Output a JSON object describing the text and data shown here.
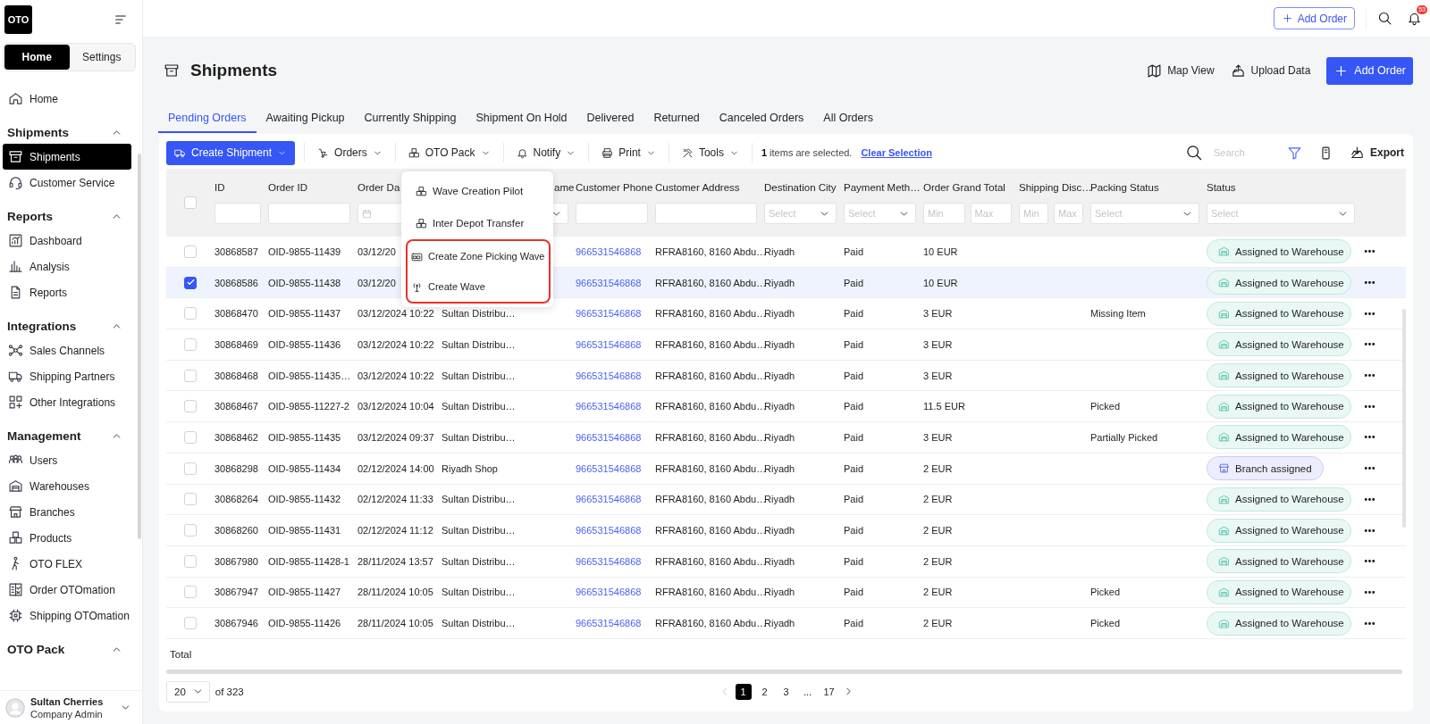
{
  "header": {
    "logo": "OTO",
    "add_order": "Add Order",
    "notifications": "53"
  },
  "sidebar": {
    "switch": [
      {
        "label": "Home",
        "selected": true
      },
      {
        "label": "Settings",
        "selected": false
      }
    ],
    "nav": [
      {
        "kind": "item",
        "label": "Home",
        "selected": false
      },
      {
        "kind": "section",
        "label": "Shipments",
        "expanded": true
      },
      {
        "kind": "item",
        "label": "Shipments",
        "selected": true
      },
      {
        "kind": "item",
        "label": "Customer Service",
        "selected": false
      },
      {
        "kind": "section",
        "label": "Reports",
        "expanded": true
      },
      {
        "kind": "item",
        "label": "Dashboard",
        "selected": false
      },
      {
        "kind": "item",
        "label": "Analysis",
        "selected": false
      },
      {
        "kind": "item",
        "label": "Reports",
        "selected": false
      },
      {
        "kind": "section",
        "label": "Integrations",
        "expanded": true
      },
      {
        "kind": "item",
        "label": "Sales Channels",
        "selected": false
      },
      {
        "kind": "item",
        "label": "Shipping Partners",
        "selected": false
      },
      {
        "kind": "item",
        "label": "Other Integrations",
        "selected": false
      },
      {
        "kind": "section",
        "label": "Management",
        "expanded": true
      },
      {
        "kind": "item",
        "label": "Users",
        "selected": false
      },
      {
        "kind": "item",
        "label": "Warehouses",
        "selected": false
      },
      {
        "kind": "item",
        "label": "Branches",
        "selected": false
      },
      {
        "kind": "item",
        "label": "Products",
        "selected": false
      },
      {
        "kind": "item",
        "label": "OTO FLEX",
        "selected": false
      },
      {
        "kind": "item",
        "label": "Order OTOmation",
        "selected": false
      },
      {
        "kind": "item",
        "label": "Shipping OTOmation",
        "selected": false
      },
      {
        "kind": "section",
        "label": "OTO Pack",
        "expanded": true
      }
    ],
    "user": {
      "name": "Sultan Cherries",
      "role": "Company Admin"
    }
  },
  "page": {
    "title": "Shipments",
    "actions": [
      {
        "kind": "link",
        "label": "Map View"
      },
      {
        "kind": "link",
        "label": "Upload Data"
      },
      {
        "kind": "primary",
        "label": "Add Order"
      }
    ]
  },
  "tabs": [
    {
      "label": "Pending Orders",
      "selected": true
    },
    {
      "label": "Awaiting Pickup",
      "selected": false
    },
    {
      "label": "Currently Shipping",
      "selected": false
    },
    {
      "label": "Shipment On Hold",
      "selected": false
    },
    {
      "label": "Delivered",
      "selected": false
    },
    {
      "label": "Returned",
      "selected": false
    },
    {
      "label": "Canceled Orders",
      "selected": false
    },
    {
      "label": "All Orders",
      "selected": false
    }
  ],
  "toolbar": {
    "buttons": [
      {
        "kind": "primary",
        "label": "Create Shipment"
      },
      {
        "kind": "menu",
        "label": "Orders"
      },
      {
        "kind": "menu",
        "label": "OTO Pack"
      },
      {
        "kind": "menu",
        "label": "Notify"
      },
      {
        "kind": "menu",
        "label": "Print"
      },
      {
        "kind": "menu",
        "label": "Tools"
      }
    ],
    "selection_note": "**1** items are selected.",
    "clear_link": "Clear Selection",
    "search": {
      "placeholder": "Search"
    },
    "export": "Export"
  },
  "menu": {
    "items": [
      {
        "label": "Wave Creation Pilot",
        "highlighted": false
      },
      {
        "label": "Inter Depot Transfer",
        "highlighted": false
      },
      {
        "label": "Create Zone Picking Wave",
        "highlighted": true
      },
      {
        "label": "Create Wave",
        "highlighted": true
      }
    ]
  },
  "table": {
    "select_all": {
      "checked": false
    },
    "columns": [
      {
        "label": "ID",
        "filter": {
          "kind": "text"
        }
      },
      {
        "label": "Order ID",
        "filter": {
          "kind": "text"
        }
      },
      {
        "label": "Order Da",
        "filter": {
          "kind": "date"
        }
      },
      {
        "label": "ame",
        "filter": {
          "kind": "select"
        }
      },
      {
        "label": "Customer Phone",
        "filter": {
          "kind": "text"
        }
      },
      {
        "label": "Customer Address",
        "filter": {
          "kind": "text"
        }
      },
      {
        "label": "Destination City",
        "filter": {
          "kind": "select",
          "placeholder": "Select"
        }
      },
      {
        "label": "Payment Meth…",
        "filter": {
          "kind": "select",
          "placeholder": "Select"
        }
      },
      {
        "label": "Order Grand Total",
        "filter": {
          "kind": "range",
          "min_placeholder": "Min",
          "max_placeholder": "Max"
        }
      },
      {
        "label": "Shipping Disc…",
        "filter": {
          "kind": "range",
          "min_placeholder": "Min",
          "max_placeholder": "Max"
        }
      },
      {
        "label": "Packing Status",
        "filter": {
          "kind": "select",
          "placeholder": "Select"
        }
      },
      {
        "label": "Status",
        "filter": {
          "kind": "select",
          "placeholder": "Select"
        }
      }
    ],
    "rows": [
      {
        "selected": false,
        "id": "30868587",
        "order_id": "OID-9855-11439",
        "order_date": "03/12/20",
        "phone": "966531546868",
        "address": "RFRA8160, 8160 Abdu…",
        "city": "Riyadh",
        "payment": "Paid",
        "total": "10 EUR",
        "status": {
          "kind": "warehouse",
          "label": "Assigned to Warehouse"
        }
      },
      {
        "selected": true,
        "id": "30868586",
        "order_id": "OID-9855-11438",
        "order_date": "03/12/20",
        "phone": "966531546868",
        "address": "RFRA8160, 8160 Abdu…",
        "city": "Riyadh",
        "payment": "Paid",
        "total": "10 EUR",
        "status": {
          "kind": "warehouse",
          "label": "Assigned to Warehouse"
        }
      },
      {
        "selected": false,
        "id": "30868470",
        "order_id": "OID-9855-11437",
        "order_date": "03/12/2024 10:22",
        "customer_name": "Sultan Distribu…",
        "phone": "966531546868",
        "address": "RFRA8160, 8160 Abdu…",
        "city": "Riyadh",
        "payment": "Paid",
        "total": "3 EUR",
        "packing_status": "Missing Item",
        "status": {
          "kind": "warehouse",
          "label": "Assigned to Warehouse"
        }
      },
      {
        "selected": false,
        "id": "30868469",
        "order_id": "OID-9855-11436",
        "order_date": "03/12/2024 10:22",
        "customer_name": "Sultan Distribu…",
        "phone": "966531546868",
        "address": "RFRA8160, 8160 Abdu…",
        "city": "Riyadh",
        "payment": "Paid",
        "total": "3 EUR",
        "status": {
          "kind": "warehouse",
          "label": "Assigned to Warehouse"
        }
      },
      {
        "selected": false,
        "id": "30868468",
        "order_id": "OID-9855-11435…",
        "order_date": "03/12/2024 10:22",
        "customer_name": "Sultan Distribu…",
        "phone": "966531546868",
        "address": "RFRA8160, 8160 Abdu…",
        "city": "Riyadh",
        "payment": "Paid",
        "total": "3 EUR",
        "status": {
          "kind": "warehouse",
          "label": "Assigned to Warehouse"
        }
      },
      {
        "selected": false,
        "id": "30868467",
        "order_id": "OID-9855-11227-2",
        "order_date": "03/12/2024 10:04",
        "customer_name": "Sultan Distribu…",
        "phone": "966531546868",
        "address": "RFRA8160, 8160 Abdu…",
        "city": "Riyadh",
        "payment": "Paid",
        "total": "11.5 EUR",
        "packing_status": "Picked",
        "status": {
          "kind": "warehouse",
          "label": "Assigned to Warehouse"
        }
      },
      {
        "selected": false,
        "id": "30868462",
        "order_id": "OID-9855-11435",
        "order_date": "03/12/2024 09:37",
        "customer_name": "Sultan Distribu…",
        "phone": "966531546868",
        "address": "RFRA8160, 8160 Abdu…",
        "city": "Riyadh",
        "payment": "Paid",
        "total": "3 EUR",
        "packing_status": "Partially Picked",
        "status": {
          "kind": "warehouse",
          "label": "Assigned to Warehouse"
        }
      },
      {
        "selected": false,
        "id": "30868298",
        "order_id": "OID-9855-11434",
        "order_date": "02/12/2024 14:00",
        "customer_name": "Riyadh Shop",
        "phone": "966531546868",
        "address": "RFRA8160, 8160 Abdu…",
        "city": "Riyadh",
        "payment": "Paid",
        "total": "2 EUR",
        "status": {
          "kind": "branch",
          "label": "Branch assigned"
        }
      },
      {
        "selected": false,
        "id": "30868264",
        "order_id": "OID-9855-11432",
        "order_date": "02/12/2024 11:33",
        "customer_name": "Sultan Distribu…",
        "phone": "966531546868",
        "address": "RFRA8160, 8160 Abdu…",
        "city": "Riyadh",
        "payment": "Paid",
        "total": "2 EUR",
        "status": {
          "kind": "warehouse",
          "label": "Assigned to Warehouse"
        }
      },
      {
        "selected": false,
        "id": "30868260",
        "order_id": "OID-9855-11431",
        "order_date": "02/12/2024 11:12",
        "customer_name": "Sultan Distribu…",
        "phone": "966531546868",
        "address": "RFRA8160, 8160 Abdu…",
        "city": "Riyadh",
        "payment": "Paid",
        "total": "2 EUR",
        "status": {
          "kind": "warehouse",
          "label": "Assigned to Warehouse"
        }
      },
      {
        "selected": false,
        "id": "30867980",
        "order_id": "OID-9855-11428-1",
        "order_date": "28/11/2024 13:57",
        "customer_name": "Sultan Distribu…",
        "phone": "966531546868",
        "address": "RFRA8160, 8160 Abdu…",
        "city": "Riyadh",
        "payment": "Paid",
        "total": "2 EUR",
        "status": {
          "kind": "warehouse",
          "label": "Assigned to Warehouse"
        }
      },
      {
        "selected": false,
        "id": "30867947",
        "order_id": "OID-9855-11427",
        "order_date": "28/11/2024 10:05",
        "customer_name": "Sultan Distribu…",
        "phone": "966531546868",
        "address": "RFRA8160, 8160 Abdu…",
        "city": "Riyadh",
        "payment": "Paid",
        "total": "2 EUR",
        "packing_status": "Picked",
        "status": {
          "kind": "warehouse",
          "label": "Assigned to Warehouse"
        }
      },
      {
        "selected": false,
        "id": "30867946",
        "order_id": "OID-9855-11426",
        "order_date": "28/11/2024 10:05",
        "customer_name": "Sultan Distribu…",
        "phone": "966531546868",
        "address": "RFRA8160, 8160 Abdu…",
        "city": "Riyadh",
        "payment": "Paid",
        "total": "2 EUR",
        "packing_status": "Picked",
        "status": {
          "kind": "warehouse",
          "label": "Assigned to Warehouse"
        }
      }
    ],
    "total_label": "Total"
  },
  "pagination": {
    "page_size": "20",
    "of": "of 323",
    "pages": [
      {
        "label": "1",
        "selected": true
      },
      {
        "label": "2",
        "selected": false
      },
      {
        "label": "3",
        "selected": false
      },
      {
        "label": "...",
        "selected": false
      },
      {
        "label": "17",
        "selected": false
      }
    ]
  }
}
